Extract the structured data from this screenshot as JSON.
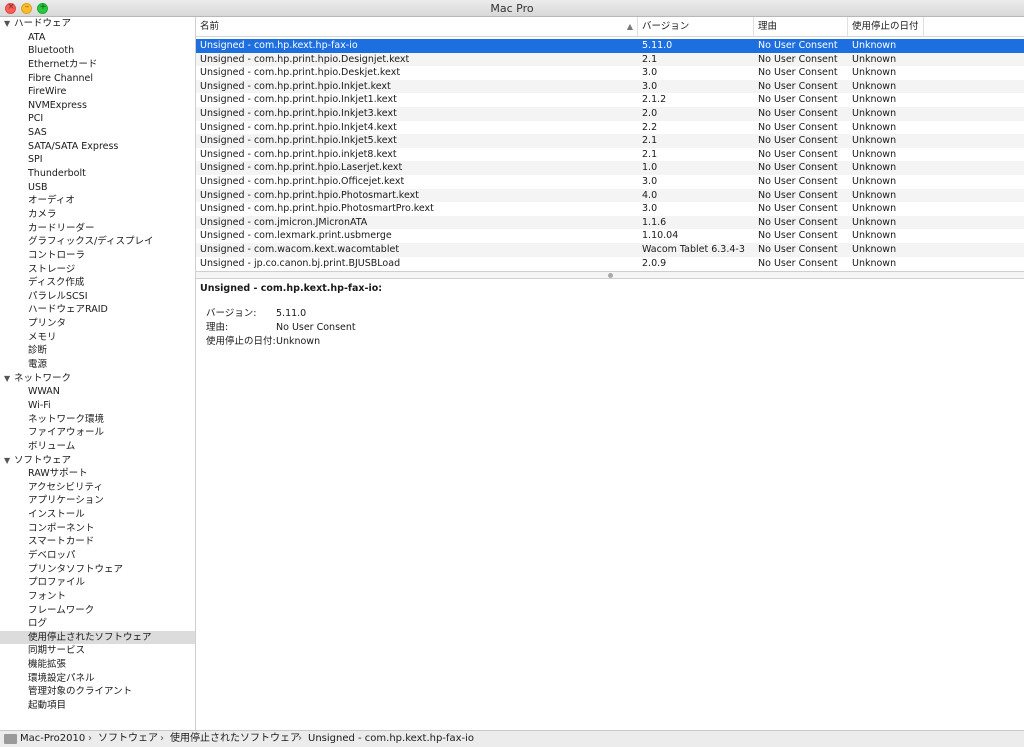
{
  "window": {
    "title": "Mac Pro"
  },
  "sidebar": {
    "sections": [
      {
        "label": "ハードウェア",
        "items": [
          "ATA",
          "Bluetooth",
          "Ethernetカード",
          "Fibre Channel",
          "FireWire",
          "NVMExpress",
          "PCI",
          "SAS",
          "SATA/SATA Express",
          "SPI",
          "Thunderbolt",
          "USB",
          "オーディオ",
          "カメラ",
          "カードリーダー",
          "グラフィックス/ディスプレイ",
          "コントローラ",
          "ストレージ",
          "ディスク作成",
          "パラレルSCSI",
          "ハードウェアRAID",
          "プリンタ",
          "メモリ",
          "診断",
          "電源"
        ]
      },
      {
        "label": "ネットワーク",
        "items": [
          "WWAN",
          "Wi-Fi",
          "ネットワーク環境",
          "ファイアウォール",
          "ボリューム"
        ]
      },
      {
        "label": "ソフトウェア",
        "items": [
          "RAWサポート",
          "アクセシビリティ",
          "アプリケーション",
          "インストール",
          "コンポーネント",
          "スマートカード",
          "デベロッパ",
          "プリンタソフトウェア",
          "プロファイル",
          "フォント",
          "フレームワーク",
          "ログ",
          "使用停止されたソフトウェア",
          "同期サービス",
          "機能拡張",
          "環境設定パネル",
          "管理対象のクライアント",
          "起動項目"
        ]
      }
    ],
    "selected_item": "使用停止されたソフトウェア"
  },
  "table": {
    "columns": [
      "名前",
      "バージョン",
      "理由",
      "使用停止の日付"
    ],
    "rows": [
      [
        "Unsigned - com.hp.kext.hp-fax-io",
        "5.11.0",
        "No User Consent",
        "Unknown"
      ],
      [
        "Unsigned - com.hp.print.hpio.Designjet.kext",
        "2.1",
        "No User Consent",
        "Unknown"
      ],
      [
        "Unsigned - com.hp.print.hpio.Deskjet.kext",
        "3.0",
        "No User Consent",
        "Unknown"
      ],
      [
        "Unsigned - com.hp.print.hpio.Inkjet.kext",
        "3.0",
        "No User Consent",
        "Unknown"
      ],
      [
        "Unsigned - com.hp.print.hpio.Inkjet1.kext",
        "2.1.2",
        "No User Consent",
        "Unknown"
      ],
      [
        "Unsigned - com.hp.print.hpio.Inkjet3.kext",
        "2.0",
        "No User Consent",
        "Unknown"
      ],
      [
        "Unsigned - com.hp.print.hpio.Inkjet4.kext",
        "2.2",
        "No User Consent",
        "Unknown"
      ],
      [
        "Unsigned - com.hp.print.hpio.Inkjet5.kext",
        "2.1",
        "No User Consent",
        "Unknown"
      ],
      [
        "Unsigned - com.hp.print.hpio.inkjet8.kext",
        "2.1",
        "No User Consent",
        "Unknown"
      ],
      [
        "Unsigned - com.hp.print.hpio.Laserjet.kext",
        "1.0",
        "No User Consent",
        "Unknown"
      ],
      [
        "Unsigned - com.hp.print.hpio.Officejet.kext",
        "3.0",
        "No User Consent",
        "Unknown"
      ],
      [
        "Unsigned - com.hp.print.hpio.Photosmart.kext",
        "4.0",
        "No User Consent",
        "Unknown"
      ],
      [
        "Unsigned - com.hp.print.hpio.PhotosmartPro.kext",
        "3.0",
        "No User Consent",
        "Unknown"
      ],
      [
        "Unsigned - com.jmicron.JMicronATA",
        "1.1.6",
        "No User Consent",
        "Unknown"
      ],
      [
        "Unsigned - com.lexmark.print.usbmerge",
        "1.10.04",
        "No User Consent",
        "Unknown"
      ],
      [
        "Unsigned - com.wacom.kext.wacomtablet",
        "Wacom Tablet 6.3.4-3",
        "No User Consent",
        "Unknown"
      ],
      [
        "Unsigned - jp.co.canon.bj.print.BJUSBLoad",
        "2.0.9",
        "No User Consent",
        "Unknown"
      ]
    ],
    "selected_row": 0
  },
  "detail": {
    "title": "Unsigned - com.hp.kext.hp-fax-io:",
    "fields": [
      {
        "key": "バージョン:",
        "value": "5.11.0"
      },
      {
        "key": "理由:",
        "value": "No User Consent"
      },
      {
        "key": "使用停止の日付:",
        "value": "Unknown"
      }
    ]
  },
  "pathbar": {
    "segments": [
      "Mac-Pro2010",
      "ソフトウェア",
      "使用停止されたソフトウェア",
      "Unsigned - com.hp.kext.hp-fax-io"
    ],
    "separator": "›"
  }
}
